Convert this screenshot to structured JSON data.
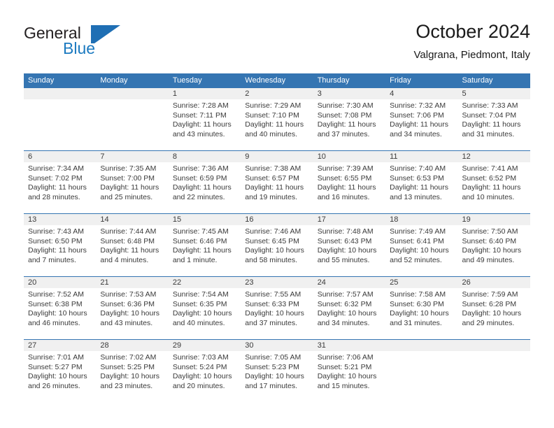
{
  "brand": {
    "word_one": "General",
    "word_two": "Blue",
    "mark": "triangle-flag-logo"
  },
  "header": {
    "title": "October 2024",
    "subtitle": "Valgrana, Piedmont, Italy"
  },
  "colors": {
    "header_blue": "#3575b2",
    "brand_blue": "#1c7ac0",
    "daynum_band": "#f0f0f0",
    "text": "#3a3a3a"
  },
  "weekday_headers": [
    "Sunday",
    "Monday",
    "Tuesday",
    "Wednesday",
    "Thursday",
    "Friday",
    "Saturday"
  ],
  "weeks": [
    [
      {
        "day": "",
        "lines": []
      },
      {
        "day": "",
        "lines": []
      },
      {
        "day": "1",
        "lines": [
          "Sunrise: 7:28 AM",
          "Sunset: 7:11 PM",
          "Daylight: 11 hours",
          "and 43 minutes."
        ]
      },
      {
        "day": "2",
        "lines": [
          "Sunrise: 7:29 AM",
          "Sunset: 7:10 PM",
          "Daylight: 11 hours",
          "and 40 minutes."
        ]
      },
      {
        "day": "3",
        "lines": [
          "Sunrise: 7:30 AM",
          "Sunset: 7:08 PM",
          "Daylight: 11 hours",
          "and 37 minutes."
        ]
      },
      {
        "day": "4",
        "lines": [
          "Sunrise: 7:32 AM",
          "Sunset: 7:06 PM",
          "Daylight: 11 hours",
          "and 34 minutes."
        ]
      },
      {
        "day": "5",
        "lines": [
          "Sunrise: 7:33 AM",
          "Sunset: 7:04 PM",
          "Daylight: 11 hours",
          "and 31 minutes."
        ]
      }
    ],
    [
      {
        "day": "6",
        "lines": [
          "Sunrise: 7:34 AM",
          "Sunset: 7:02 PM",
          "Daylight: 11 hours",
          "and 28 minutes."
        ]
      },
      {
        "day": "7",
        "lines": [
          "Sunrise: 7:35 AM",
          "Sunset: 7:00 PM",
          "Daylight: 11 hours",
          "and 25 minutes."
        ]
      },
      {
        "day": "8",
        "lines": [
          "Sunrise: 7:36 AM",
          "Sunset: 6:59 PM",
          "Daylight: 11 hours",
          "and 22 minutes."
        ]
      },
      {
        "day": "9",
        "lines": [
          "Sunrise: 7:38 AM",
          "Sunset: 6:57 PM",
          "Daylight: 11 hours",
          "and 19 minutes."
        ]
      },
      {
        "day": "10",
        "lines": [
          "Sunrise: 7:39 AM",
          "Sunset: 6:55 PM",
          "Daylight: 11 hours",
          "and 16 minutes."
        ]
      },
      {
        "day": "11",
        "lines": [
          "Sunrise: 7:40 AM",
          "Sunset: 6:53 PM",
          "Daylight: 11 hours",
          "and 13 minutes."
        ]
      },
      {
        "day": "12",
        "lines": [
          "Sunrise: 7:41 AM",
          "Sunset: 6:52 PM",
          "Daylight: 11 hours",
          "and 10 minutes."
        ]
      }
    ],
    [
      {
        "day": "13",
        "lines": [
          "Sunrise: 7:43 AM",
          "Sunset: 6:50 PM",
          "Daylight: 11 hours",
          "and 7 minutes."
        ]
      },
      {
        "day": "14",
        "lines": [
          "Sunrise: 7:44 AM",
          "Sunset: 6:48 PM",
          "Daylight: 11 hours",
          "and 4 minutes."
        ]
      },
      {
        "day": "15",
        "lines": [
          "Sunrise: 7:45 AM",
          "Sunset: 6:46 PM",
          "Daylight: 11 hours",
          "and 1 minute."
        ]
      },
      {
        "day": "16",
        "lines": [
          "Sunrise: 7:46 AM",
          "Sunset: 6:45 PM",
          "Daylight: 10 hours",
          "and 58 minutes."
        ]
      },
      {
        "day": "17",
        "lines": [
          "Sunrise: 7:48 AM",
          "Sunset: 6:43 PM",
          "Daylight: 10 hours",
          "and 55 minutes."
        ]
      },
      {
        "day": "18",
        "lines": [
          "Sunrise: 7:49 AM",
          "Sunset: 6:41 PM",
          "Daylight: 10 hours",
          "and 52 minutes."
        ]
      },
      {
        "day": "19",
        "lines": [
          "Sunrise: 7:50 AM",
          "Sunset: 6:40 PM",
          "Daylight: 10 hours",
          "and 49 minutes."
        ]
      }
    ],
    [
      {
        "day": "20",
        "lines": [
          "Sunrise: 7:52 AM",
          "Sunset: 6:38 PM",
          "Daylight: 10 hours",
          "and 46 minutes."
        ]
      },
      {
        "day": "21",
        "lines": [
          "Sunrise: 7:53 AM",
          "Sunset: 6:36 PM",
          "Daylight: 10 hours",
          "and 43 minutes."
        ]
      },
      {
        "day": "22",
        "lines": [
          "Sunrise: 7:54 AM",
          "Sunset: 6:35 PM",
          "Daylight: 10 hours",
          "and 40 minutes."
        ]
      },
      {
        "day": "23",
        "lines": [
          "Sunrise: 7:55 AM",
          "Sunset: 6:33 PM",
          "Daylight: 10 hours",
          "and 37 minutes."
        ]
      },
      {
        "day": "24",
        "lines": [
          "Sunrise: 7:57 AM",
          "Sunset: 6:32 PM",
          "Daylight: 10 hours",
          "and 34 minutes."
        ]
      },
      {
        "day": "25",
        "lines": [
          "Sunrise: 7:58 AM",
          "Sunset: 6:30 PM",
          "Daylight: 10 hours",
          "and 31 minutes."
        ]
      },
      {
        "day": "26",
        "lines": [
          "Sunrise: 7:59 AM",
          "Sunset: 6:28 PM",
          "Daylight: 10 hours",
          "and 29 minutes."
        ]
      }
    ],
    [
      {
        "day": "27",
        "lines": [
          "Sunrise: 7:01 AM",
          "Sunset: 5:27 PM",
          "Daylight: 10 hours",
          "and 26 minutes."
        ]
      },
      {
        "day": "28",
        "lines": [
          "Sunrise: 7:02 AM",
          "Sunset: 5:25 PM",
          "Daylight: 10 hours",
          "and 23 minutes."
        ]
      },
      {
        "day": "29",
        "lines": [
          "Sunrise: 7:03 AM",
          "Sunset: 5:24 PM",
          "Daylight: 10 hours",
          "and 20 minutes."
        ]
      },
      {
        "day": "30",
        "lines": [
          "Sunrise: 7:05 AM",
          "Sunset: 5:23 PM",
          "Daylight: 10 hours",
          "and 17 minutes."
        ]
      },
      {
        "day": "31",
        "lines": [
          "Sunrise: 7:06 AM",
          "Sunset: 5:21 PM",
          "Daylight: 10 hours",
          "and 15 minutes."
        ]
      },
      {
        "day": "",
        "lines": []
      },
      {
        "day": "",
        "lines": []
      }
    ]
  ]
}
